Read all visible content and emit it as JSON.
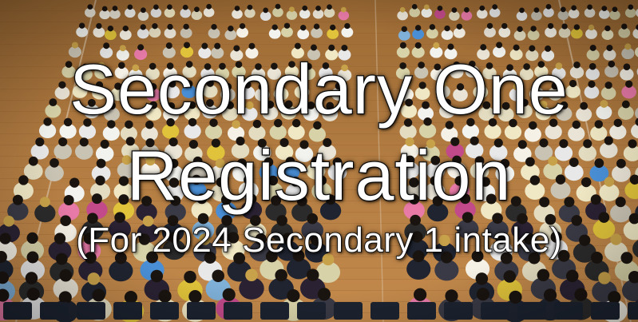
{
  "banner": {
    "title_line_1": "Secondary One",
    "title_line_2": "Registration",
    "subtitle": "(For 2024 Secondary 1 intake)"
  },
  "colors": {
    "floor": "#b07a3e",
    "title_text": "#ffffff",
    "title_outline": "#1a1a1a"
  }
}
